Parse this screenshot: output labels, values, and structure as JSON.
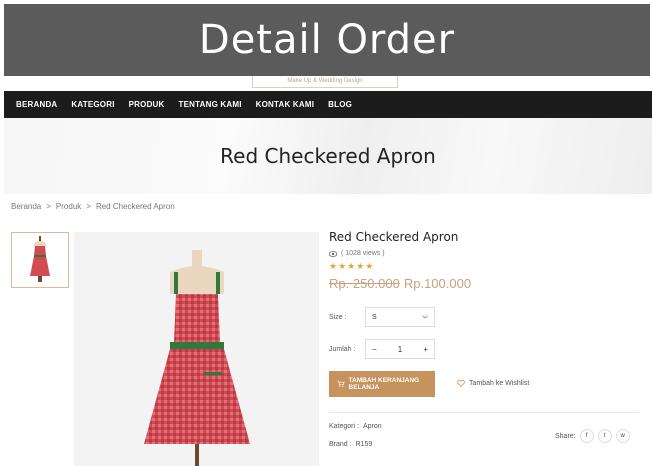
{
  "banner": {
    "title": "Detail Order"
  },
  "logo": {
    "tagline": "Make Up & Wedding Design"
  },
  "nav": {
    "items": [
      "BERANDA",
      "KATEGORI",
      "PRODUK",
      "TENTANG KAMI",
      "KONTAK KAMI",
      "BLOG"
    ]
  },
  "hero": {
    "title": "Red Checkered Apron"
  },
  "breadcrumb": {
    "items": [
      "Beranda",
      "Produk",
      "Red Checkered Apron"
    ],
    "separator": ">"
  },
  "product": {
    "title": "Red Checkered Apron",
    "views": "( 1028 views )",
    "rating": 5,
    "stars": "★★★★★",
    "old_price": "Rp. 250.000",
    "new_price": "Rp.100.000",
    "size_label": "Size :",
    "size_value": "S",
    "qty_label": "Jumlah :",
    "qty_minus": "−",
    "qty_value": "1",
    "qty_plus": "+",
    "cart_button": "TAMBAH KERANJANG BELANJA",
    "wishlist": "Tambah ke Wishlist",
    "category_label": "Kategori :",
    "category_value": "Apron",
    "brand_label": "Brand :",
    "brand_value": "R159",
    "share_label": "Share:"
  },
  "colors": {
    "banner_bg": "#5b5b5b",
    "nav_bg": "#1c1c1c",
    "accent": "#c6935f",
    "price": "#c9a27e",
    "star": "#e4a33b",
    "apron_red": "#d24b52",
    "apron_green": "#2f7a3a"
  },
  "icons": {
    "eye": "eye-icon",
    "cart": "cart-icon",
    "heart": "heart-icon",
    "facebook": "facebook-icon",
    "twitter": "twitter-icon",
    "whatsapp": "whatsapp-icon",
    "chevron": "chevron-down-icon"
  }
}
